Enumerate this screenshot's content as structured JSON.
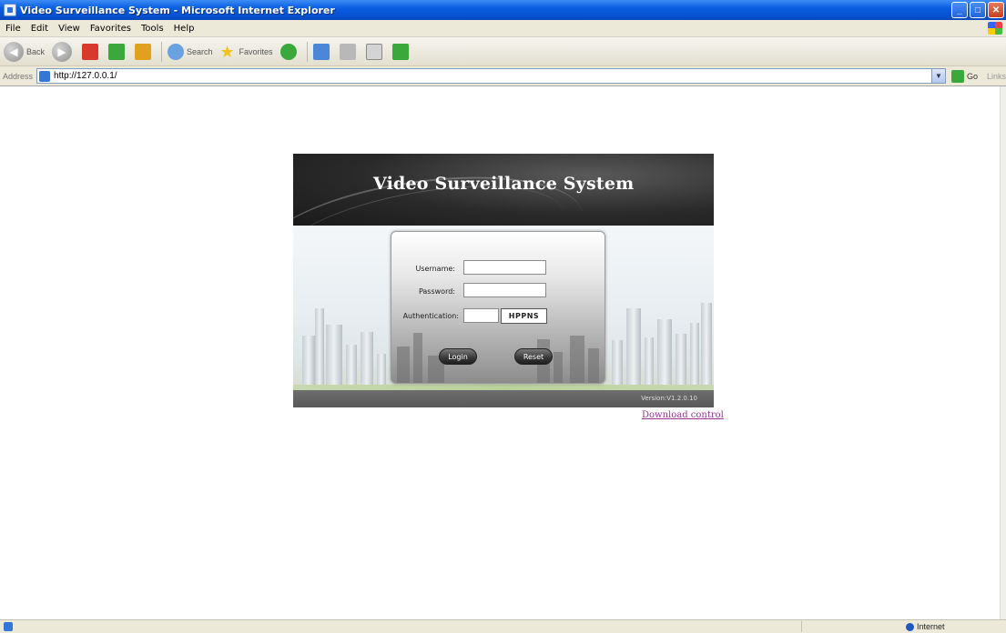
{
  "window": {
    "title": "Video Surveillance System - Microsoft Internet Explorer"
  },
  "menu": [
    "File",
    "Edit",
    "View",
    "Favorites",
    "Tools",
    "Help"
  ],
  "toolbar": {
    "back_label": "Back",
    "search_label": "Search",
    "favorites_label": "Favorites"
  },
  "address": {
    "label": "Address",
    "url": "http://127.0.0.1/",
    "go_label": "Go",
    "links_label": "Links"
  },
  "page": {
    "banner_title": "Video Surveillance System",
    "username_label": "Username:",
    "password_label": "Password:",
    "auth_label": "Authentication:",
    "username_value": "",
    "password_value": "",
    "auth_value": "",
    "captcha_text": "HPPNS",
    "login_label": "Login",
    "reset_label": "Reset",
    "version": "Version:V1.2.0.10",
    "download_link": "Download control"
  },
  "status": {
    "zone": "Internet"
  }
}
